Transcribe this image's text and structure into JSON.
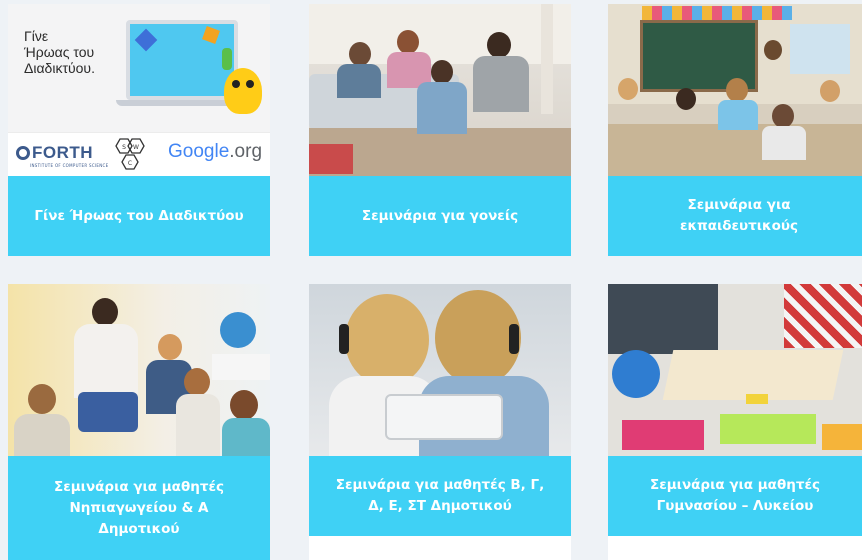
{
  "cards": [
    {
      "caption": [
        "Γίνε Ήρωας του Διαδικτύου"
      ],
      "image": {
        "subject": "laptop with robot and gems",
        "title_lines": [
          "Γίνε",
          "Ήρωας του",
          "Διαδικτύου."
        ],
        "logos": {
          "forth": "FORTH",
          "forth_sub": "INSTITUTE OF COMPUTER SCIENCE",
          "swc_letters": [
            "S",
            "W",
            "C"
          ],
          "google": "Google",
          "google_suffix": ".org"
        }
      }
    },
    {
      "caption": [
        "Σεμινάρια για γονείς"
      ],
      "image": {
        "subject": "parents with children"
      }
    },
    {
      "caption": [
        "Σεμινάρια για",
        "εκπαιδευτικούς"
      ],
      "image": {
        "subject": "classroom with students"
      }
    },
    {
      "caption": [
        "Σεμινάρια για μαθητές",
        "Νηπιαγωγείου & Α",
        "Δημοτικού"
      ],
      "image": {
        "subject": "teacher with young children"
      }
    },
    {
      "caption": [
        "Σεμινάρια για μαθητές Β, Γ,",
        "Δ, Ε, ΣΤ Δημοτικού"
      ],
      "image": {
        "subject": "two kids with headphones and tablet"
      }
    },
    {
      "caption": [
        "Σεμινάρια για μαθητές",
        "Γυμνασίου – Λυκείου"
      ],
      "image": {
        "subject": "students studying with books"
      }
    }
  ],
  "colors": {
    "caption_bg": "#3fd1f5",
    "caption_text": "#ffffff",
    "page_bg": "#eef2f6",
    "forth_blue": "#3c5a8c",
    "google_blue": "#4285f4",
    "google_red": "#ea4335",
    "google_yellow": "#fbbc05",
    "google_green": "#34a853",
    "org_grey": "#5f6368"
  }
}
